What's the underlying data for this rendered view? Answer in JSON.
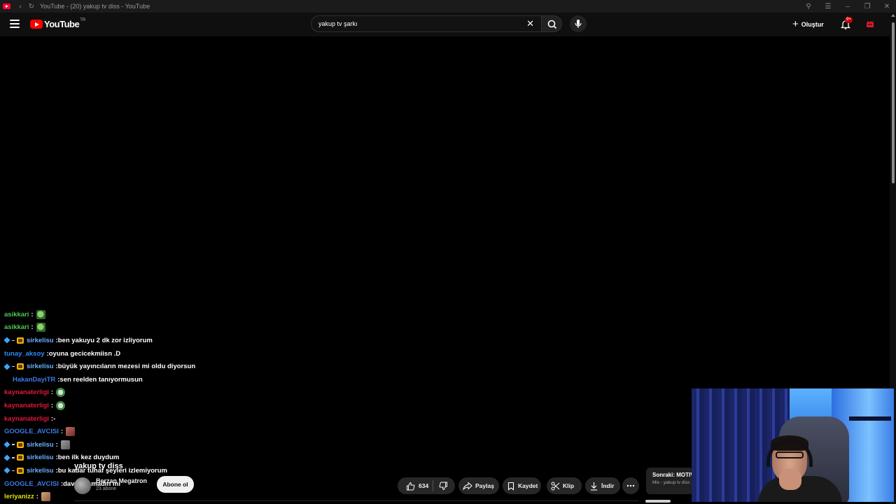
{
  "browser": {
    "tab_title": "YouTube - (20) yakup tv diss - YouTube"
  },
  "header": {
    "logo_text": "YouTube",
    "country_code": "TR",
    "search_value": "yakup tv şarkı",
    "create_label": "Oluştur",
    "notification_badge": "9+"
  },
  "chat": [
    {
      "user": "asikkari",
      "user_color": "#4ec94e",
      "badges": [],
      "message": "",
      "emote": "pepe"
    },
    {
      "user": "asikkari",
      "user_color": "#4ec94e",
      "badges": [],
      "message": "",
      "emote": "pepe"
    },
    {
      "user": "sirkelisu",
      "user_color": "#6ab0ff",
      "badges": [
        "cube",
        "dash",
        "sub"
      ],
      "message": "ben yakuyu 2 dk zor izliyorum",
      "emote": ""
    },
    {
      "user": "tunay_aksoy",
      "user_color": "#2f8bff",
      "badges": [],
      "message": "oyuna gecicekmiisn .D",
      "emote": ""
    },
    {
      "user": "sirkelisu",
      "user_color": "#6ab0ff",
      "badges": [
        "cube",
        "dash",
        "sub"
      ],
      "message": "büyük yayıncıların mezesi mi oldu diyorsun",
      "emote": ""
    },
    {
      "user": "HakanDayiTR",
      "user_color": "#3d7be6",
      "badges": [
        "indent"
      ],
      "message": "sen reelden tanıyormusun",
      "emote": ""
    },
    {
      "user": "kaynanaterligi",
      "user_color": "#e0183a",
      "badges": [],
      "message": "",
      "emote": "ball"
    },
    {
      "user": "kaynanaterligi",
      "user_color": "#e0183a",
      "badges": [],
      "message": "",
      "emote": "ball"
    },
    {
      "user": "kaynanaterligi",
      "user_color": "#e0183a",
      "badges": [],
      "message": "-",
      "emote": ""
    },
    {
      "user": "GOOGLE_AVCISI",
      "user_color": "#3d7be6",
      "badges": [],
      "message": "",
      "emote": "face"
    },
    {
      "user": "sirkelisu",
      "user_color": "#6ab0ff",
      "badges": [
        "cube",
        "dash",
        "sub"
      ],
      "message": "",
      "emote": "gray"
    },
    {
      "user": "sirkelisu",
      "user_color": "#6ab0ff",
      "badges": [
        "cube",
        "dash",
        "sub"
      ],
      "message": "ben ilk kez duydum",
      "emote": ""
    },
    {
      "user": "sirkelisu",
      "user_color": "#6ab0ff",
      "badges": [
        "cube",
        "dash",
        "sub"
      ],
      "message": "bu kadar tuhaf şeyleri izlemiyorum",
      "emote": ""
    },
    {
      "user": "GOOGLE_AVCISI",
      "user_color": "#3d7be6",
      "badges": [],
      "message": "dava açamadın mı",
      "emote": ""
    },
    {
      "user": "leriyanizz",
      "user_color": "#e3e30a",
      "badges": [],
      "message": "",
      "emote": "tan"
    }
  ],
  "video": {
    "title": "yakup tv diss",
    "channel_name": "Berzan Megatron",
    "subscribers": "23 abone",
    "subscribe_label": "Abone ol",
    "like_count": "634",
    "share_label": "Paylaş",
    "save_label": "Kaydet",
    "clip_label": "Klip",
    "download_label": "İndir",
    "up_next_label": "Sonraki: MOTIV",
    "up_next_sub": "Mix - yakup tv diss"
  }
}
